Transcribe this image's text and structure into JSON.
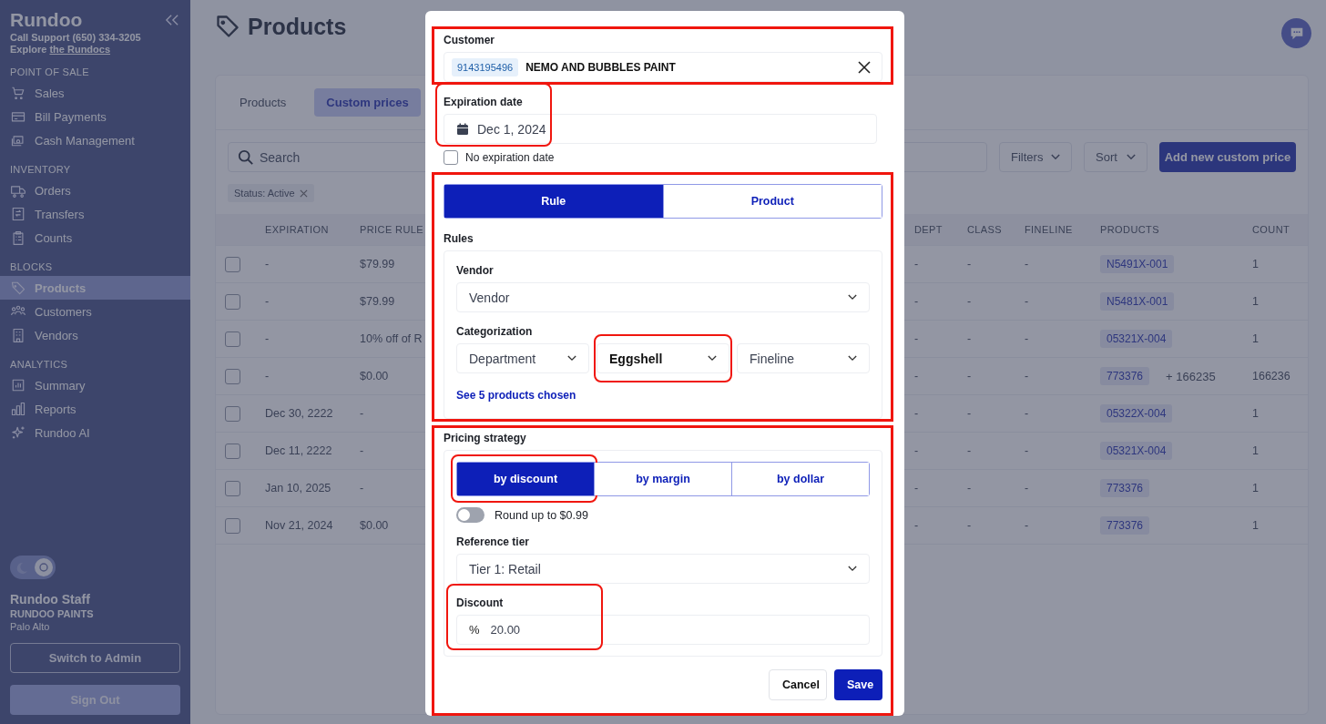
{
  "sidebar": {
    "brand": "Rundoo",
    "support": "Call Support (650) 334-3205",
    "explore_prefix": "Explore",
    "explore_link": "the Rundocs",
    "sections": [
      {
        "heading": "POINT OF SALE",
        "items": [
          {
            "label": "Sales",
            "selected": false
          },
          {
            "label": "Bill Payments",
            "selected": false
          },
          {
            "label": "Cash Management",
            "selected": false
          }
        ]
      },
      {
        "heading": "INVENTORY",
        "items": [
          {
            "label": "Orders",
            "selected": false
          },
          {
            "label": "Transfers",
            "selected": false
          },
          {
            "label": "Counts",
            "selected": false
          }
        ]
      },
      {
        "heading": "BLOCKS",
        "items": [
          {
            "label": "Products",
            "selected": true
          },
          {
            "label": "Customers",
            "selected": false
          },
          {
            "label": "Vendors",
            "selected": false
          }
        ]
      },
      {
        "heading": "ANALYTICS",
        "items": [
          {
            "label": "Summary",
            "selected": false
          },
          {
            "label": "Reports",
            "selected": false
          },
          {
            "label": "Rundoo AI",
            "selected": false
          }
        ]
      }
    ],
    "light_mode": true,
    "user": {
      "name": "Rundoo Staff",
      "company": "RUNDOO PAINTS",
      "location": "Palo Alto"
    },
    "buttons": [
      {
        "label": "Switch to Admin",
        "kind": "outline"
      },
      {
        "label": "Sign Out",
        "kind": "filled"
      }
    ]
  },
  "page": {
    "title": "Products",
    "tabs": [
      {
        "label": "Products",
        "selected": false
      },
      {
        "label": "Custom prices",
        "selected": true
      }
    ],
    "search": {
      "placeholder": "Search"
    },
    "filters": "Filters",
    "sort": "Sort",
    "add_button": "Add new custom price",
    "chips": [
      {
        "label": "Status: Active"
      }
    ],
    "table": {
      "columns": [
        "EXPIRATION",
        "PRICE RULE",
        "DEPT",
        "CLASS",
        "FINELINE",
        "PRODUCTS",
        "COUNT"
      ],
      "rows": [
        {
          "checked": false,
          "expiration": "-",
          "price_rule": "$79.99",
          "dept": "-",
          "class": "-",
          "fineline": "-",
          "product": "N5491X-001",
          "count": "1"
        },
        {
          "checked": false,
          "expiration": "-",
          "price_rule": "$79.99",
          "dept": "-",
          "class": "-",
          "fineline": "-",
          "product": "N5481X-001",
          "count": "1"
        },
        {
          "checked": false,
          "expiration": "-",
          "price_rule": "10% off of R",
          "dept": "-",
          "class": "-",
          "fineline": "-",
          "product": "05321X-004",
          "count": "1"
        },
        {
          "checked": false,
          "expiration": "-",
          "price_rule": "$0.00",
          "dept": "-",
          "class": "-",
          "fineline": "-",
          "product": "773376",
          "extra": "+ 166235",
          "count": "166236"
        },
        {
          "checked": false,
          "expiration": "Dec 30, 2222",
          "price_rule": "-",
          "dept": "-",
          "class": "-",
          "fineline": "-",
          "product": "05322X-004",
          "count": "1"
        },
        {
          "checked": false,
          "expiration": "Dec 11, 2222",
          "price_rule": "-",
          "dept": "-",
          "class": "-",
          "fineline": "-",
          "product": "05321X-004",
          "count": "1"
        },
        {
          "checked": false,
          "expiration": "Jan 10, 2025",
          "price_rule": "-",
          "dept": "-",
          "class": "-",
          "fineline": "-",
          "product": "773376",
          "count": "1"
        },
        {
          "checked": false,
          "expiration": "Nov 21, 2024",
          "price_rule": "$0.00",
          "dept": "-",
          "class": "-",
          "fineline": "-",
          "product": "773376",
          "count": "1"
        }
      ]
    }
  },
  "modal": {
    "customer": {
      "label": "Customer",
      "id": "9143195496",
      "name": "NEMO AND BUBBLES PAINT"
    },
    "expiration": {
      "label": "Expiration date",
      "value": "Dec 1, 2024"
    },
    "no_expiration": {
      "label": "No expiration date",
      "checked": false
    },
    "mode_tabs": [
      {
        "label": "Rule",
        "selected": true
      },
      {
        "label": "Product",
        "selected": false
      }
    ],
    "rules_heading": "Rules",
    "vendor": {
      "label": "Vendor",
      "value": "Vendor"
    },
    "categorization": {
      "label": "Categorization",
      "selects": [
        {
          "value": "Department",
          "filled": false
        },
        {
          "value": "Eggshell",
          "filled": true
        },
        {
          "value": "Fineline",
          "filled": false
        }
      ]
    },
    "chosen_link": "See 5 products chosen",
    "pricing": {
      "label": "Pricing strategy",
      "tabs": [
        {
          "label": "by discount",
          "selected": true
        },
        {
          "label": "by margin",
          "selected": false
        },
        {
          "label": "by dollar",
          "selected": false
        }
      ],
      "round_toggle": {
        "label": "Round up to $0.99",
        "on": false
      },
      "reference_tier": {
        "label": "Reference tier",
        "value": "Tier 1: Retail"
      },
      "discount": {
        "label": "Discount",
        "prefix": "%",
        "value": "20.00"
      }
    },
    "buttons": [
      {
        "label": "Cancel",
        "kind": "secondary"
      },
      {
        "label": "Save",
        "kind": "primary"
      }
    ]
  }
}
